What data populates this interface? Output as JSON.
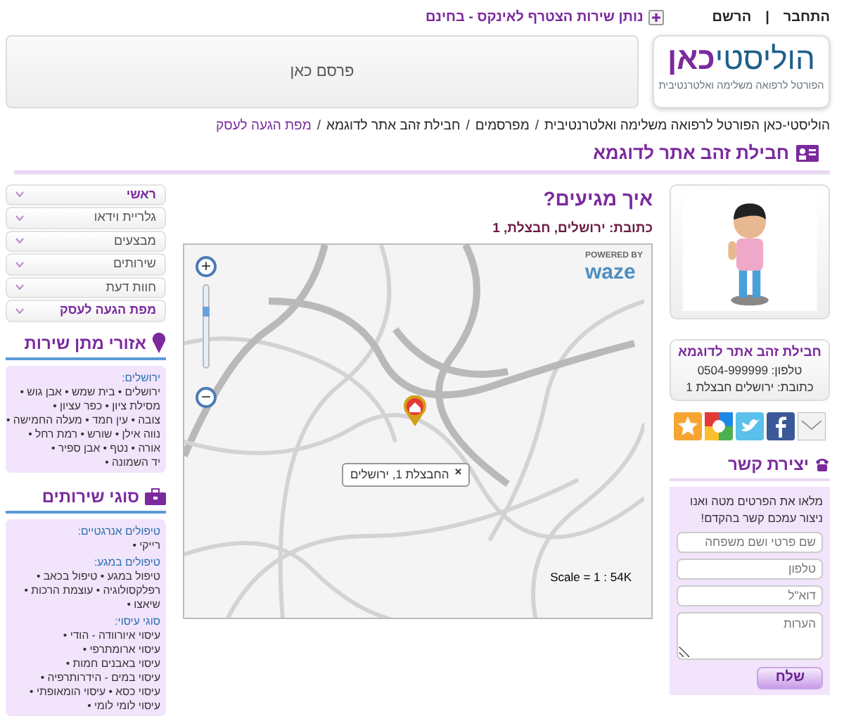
{
  "top_bar": {
    "login": "התחבר",
    "separator": "|",
    "register": "הרשם",
    "join": "נותן שירות הצטרף לאינקס - בחינם"
  },
  "logo": {
    "title": "הוליסטי",
    "title_accent": "כאן",
    "tagline": "הפורטל לרפואה משלימה ואלטרנטיבית"
  },
  "ad": {
    "text": "פרסם כאן"
  },
  "breadcrumb": {
    "separator": "/",
    "items": [
      {
        "label": "הוליסטי-כאן הפורטל לרפואה משלימה ואלטרנטיבית",
        "current": false
      },
      {
        "label": "מפרסמים",
        "current": false
      },
      {
        "label": "חבילת זהב אתר לדוגמא",
        "current": false
      },
      {
        "label": "מפת הגעה לעסק",
        "current": true
      }
    ]
  },
  "page_title": "חבילת זהב אתר לדוגמא",
  "profile": {
    "name": "חבילת זהב אתר לדוגמא",
    "phone": "טלפון: 0504-999999",
    "address": "כתובת: ירושלים חבצלת 1"
  },
  "share_icons": [
    {
      "kind": "mail"
    },
    {
      "kind": "facebook"
    },
    {
      "kind": "twitter"
    },
    {
      "kind": "google"
    },
    {
      "kind": "star"
    }
  ],
  "contact": {
    "title": "יצירת קשר",
    "intro": "מלאו את הפרטים מטה ואנו ניצור עמכם קשר בהקדם!",
    "fields": [
      {
        "placeholder": "שם פרטי ושם משפחה",
        "kind": "input"
      },
      {
        "placeholder": "טלפון",
        "kind": "input"
      },
      {
        "placeholder": "דוא\"ל",
        "kind": "input"
      },
      {
        "placeholder": "הערות",
        "kind": "textarea"
      }
    ],
    "submit": "שלח"
  },
  "directions": {
    "title": "איך מגיעים?",
    "address": "כתובת: ירושלים, חבצלת, 1"
  },
  "map": {
    "zoom_in": "+",
    "zoom_out": "−",
    "zoom_slider": {
      "level": 0.72
    },
    "powered_by": "POWERED BY",
    "brand": "waze",
    "popup": "החבצלת 1, ירושלים",
    "popup_close": "×",
    "scale": "Scale = 1 : 54K"
  },
  "nav": [
    {
      "label": "ראשי",
      "highlighted": true
    },
    {
      "label": "גלריית וידאו",
      "highlighted": false
    },
    {
      "label": "מבצעים",
      "highlighted": false
    },
    {
      "label": "שירותים",
      "highlighted": false
    },
    {
      "label": "חוות דעת",
      "highlighted": false
    },
    {
      "label": "מפת הגעה לעסק",
      "highlighted": true
    }
  ],
  "service_areas": {
    "title": "אזורי מתן שירות",
    "groups": [
      {
        "heading": "ירושלים:",
        "lines": [
          "ירושלים • בית שמש • אבן גוש •",
          "מסילת ציון • כפר עציון •",
          "צובה • עין חמד • מעלה החמישה •",
          "נווה אילן • שורש • רמת רחל •",
          "אורה • נטף • אבן ספיר •",
          "יד השמונה •"
        ]
      }
    ]
  },
  "service_types": {
    "title": "סוגי שירותים",
    "groups": [
      {
        "heading": "טיפולים אנרגטיים:",
        "lines": [
          "רייקי •"
        ]
      },
      {
        "heading": "טיפולים במגע:",
        "lines": [
          "טיפול במגע • טיפול בכאב •",
          "רפלקסולוגיה • עוצמת הרכות •",
          "שיאצו •"
        ]
      },
      {
        "heading": "סוגי עיסוי:",
        "lines": [
          "עיסוי איורוודה - הודי •",
          "עיסוי ארומתרפי •",
          "עיסוי באבנים חמות •",
          "עיסוי במים - הידרותרפיה •",
          "עיסוי כסא • עיסוי הומאופתי •",
          "עיסוי לומי לומי •"
        ]
      }
    ]
  }
}
